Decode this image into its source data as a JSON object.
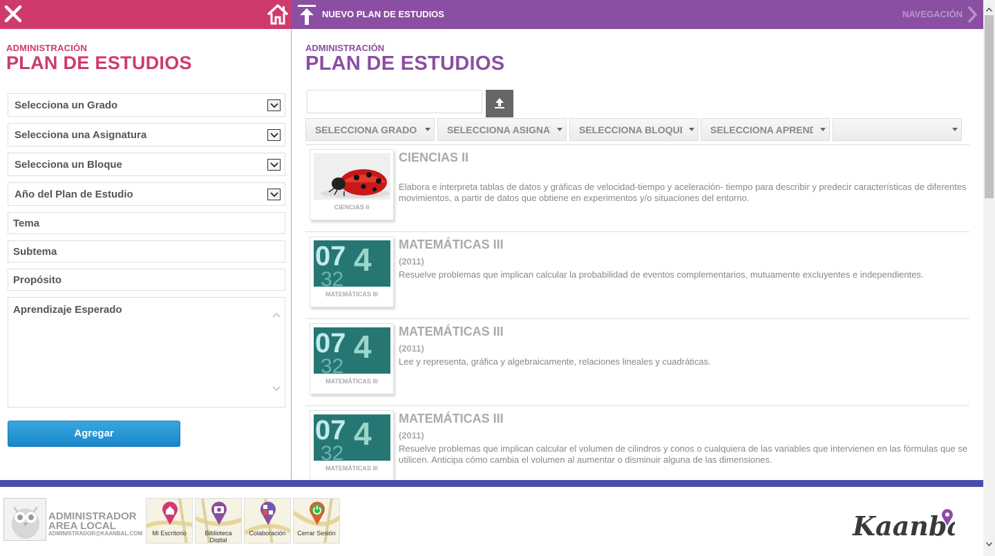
{
  "left_panel": {
    "eyebrow": "ADMINISTRACIÓN",
    "title": "PLAN DE ESTUDIOS",
    "selects": [
      {
        "label": "Selecciona un Grado"
      },
      {
        "label": "Selecciona una Asignatura"
      },
      {
        "label": "Selecciona un Bloque"
      },
      {
        "label": "Año del Plan de Estudio"
      }
    ],
    "inputs": {
      "tema": "Tema",
      "subtema": "Subtema",
      "proposito": "Propósito",
      "aprendizaje": "Aprendizaje Esperado"
    },
    "add_button": "Agregar"
  },
  "right_panel": {
    "topbar_label": "NUEVO PLAN DE ESTUDIOS",
    "nav_label": "NAVEGACIÓN",
    "eyebrow": "ADMINISTRACIÓN",
    "title": "PLAN DE ESTUDIOS",
    "filters": [
      "SELECCIONA GRADO",
      "SELECCIONA ASIGNATURA",
      "SELECCIONA BLOQUE",
      "SELECCIONA APRENDIZAJE",
      ""
    ],
    "results": [
      {
        "thumb": "ladybug",
        "caption": "CIENCIAS II",
        "title": "CIENCIAS II",
        "year": "",
        "description": "Elabora e interpreta tablas de datos y gráficas de velocidad-tiempo y aceleración- tiempo para describir y predecir características de diferentes movimientos, a partir de datos que obtiene en experimentos y/o situaciones del entorno."
      },
      {
        "thumb": "numbers",
        "caption": "MATEMÁTICAS III",
        "title": "MATEMÁTICAS III",
        "year": "(2011)",
        "description": "Resuelve problemas que implican calcular la probabilidad de eventos complementarios, mutuamente excluyentes e independientes."
      },
      {
        "thumb": "numbers",
        "caption": "MATEMÁTICAS III",
        "title": "MATEMÁTICAS III",
        "year": "(2011)",
        "description": "Lee y representa, gráfica y algebraicamente, relaciones lineales y cuadráticas."
      },
      {
        "thumb": "numbers",
        "caption": "MATEMÁTICAS III",
        "title": "MATEMÁTICAS III",
        "year": "(2011)",
        "description": "Resuelve problemas que implican calcular el volumen de cilindros y conos o cualquiera de las variables que intervienen en las fórmulas que se utilicen. Anticipa cómo cambia el volumen al aumentar o disminuir alguna de las dimensiones."
      }
    ]
  },
  "footer": {
    "user_name_line1": "ADMINISTRADOR",
    "user_name_line2": "AREA LOCAL",
    "user_email": "ADMINISTRADOR@KAANBAL.COM",
    "apps": [
      {
        "label": "Mi Escritorio",
        "icon": "home-pin-icon",
        "color": "#d13a77"
      },
      {
        "label": "Biblioteca Digital",
        "icon": "camera-pin-icon",
        "color": "#8a4fa2"
      },
      {
        "label": "Colaboración",
        "icon": "grid-pin-icon",
        "color": "#8a4fa2"
      },
      {
        "label": "Cerrar Sesión",
        "icon": "power-pin-icon",
        "color": "#e05a2a"
      }
    ],
    "logo_text": "Kaanbal"
  },
  "colors": {
    "left_accent": "#cf3a6e",
    "right_accent": "#8a4fa2",
    "footer_line": "#4c4caa",
    "button_blue": "#1a86c8"
  }
}
